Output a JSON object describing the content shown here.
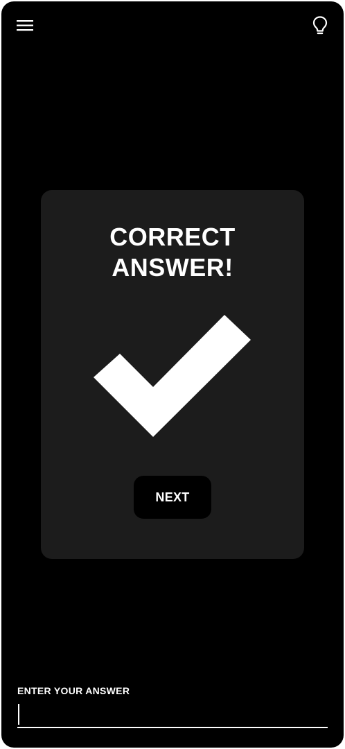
{
  "header": {
    "menu_icon": "hamburger-menu-icon",
    "hint_icon": "lightbulb-icon"
  },
  "result_card": {
    "title_line1": "CORRECT",
    "title_line2": "ANSWER!",
    "icon": "checkmark-icon",
    "next_label": "NEXT"
  },
  "answer": {
    "label": "ENTER YOUR ANSWER",
    "value": ""
  },
  "colors": {
    "background": "#000000",
    "card": "#1c1c1c",
    "text": "#ffffff",
    "button": "#000000"
  }
}
